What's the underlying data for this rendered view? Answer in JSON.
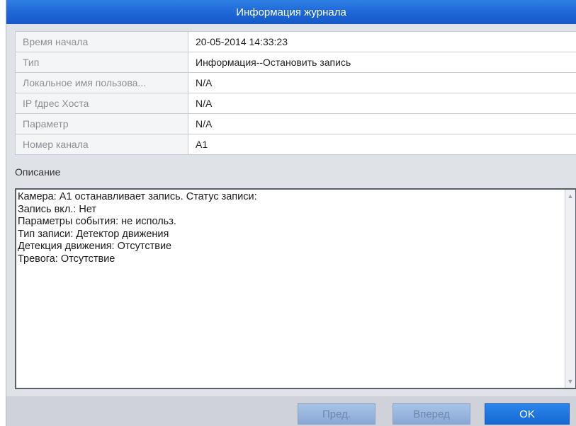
{
  "dialog": {
    "title": "Информация журнала"
  },
  "info_rows": [
    {
      "label": "Время начала",
      "value": "20-05-2014 14:33:23"
    },
    {
      "label": "Тип",
      "value": "Информация--Остановить запись"
    },
    {
      "label": "Локальное имя пользова...",
      "value": "N/A"
    },
    {
      "label": "IP fдрес Хоста",
      "value": "N/A"
    },
    {
      "label": "Параметр",
      "value": "N/A"
    },
    {
      "label": "Номер канала",
      "value": "A1"
    }
  ],
  "description": {
    "label": "Описание",
    "lines": [
      "Камера: A1 останавливает запись. Статус записи:",
      "Запись вкл.: Нет",
      "Параметры события: не использ.",
      "Тип записи: Детектор движения",
      "Детекция движения: Отсутствие",
      "Тревога: Отсутствие"
    ]
  },
  "buttons": {
    "prev": "Пред.",
    "next": "Вперед",
    "ok": "OK"
  },
  "colors": {
    "title_bar": "#1d66d6",
    "ok_button": "#1767d3",
    "disabled_button": "#88a8d6"
  }
}
